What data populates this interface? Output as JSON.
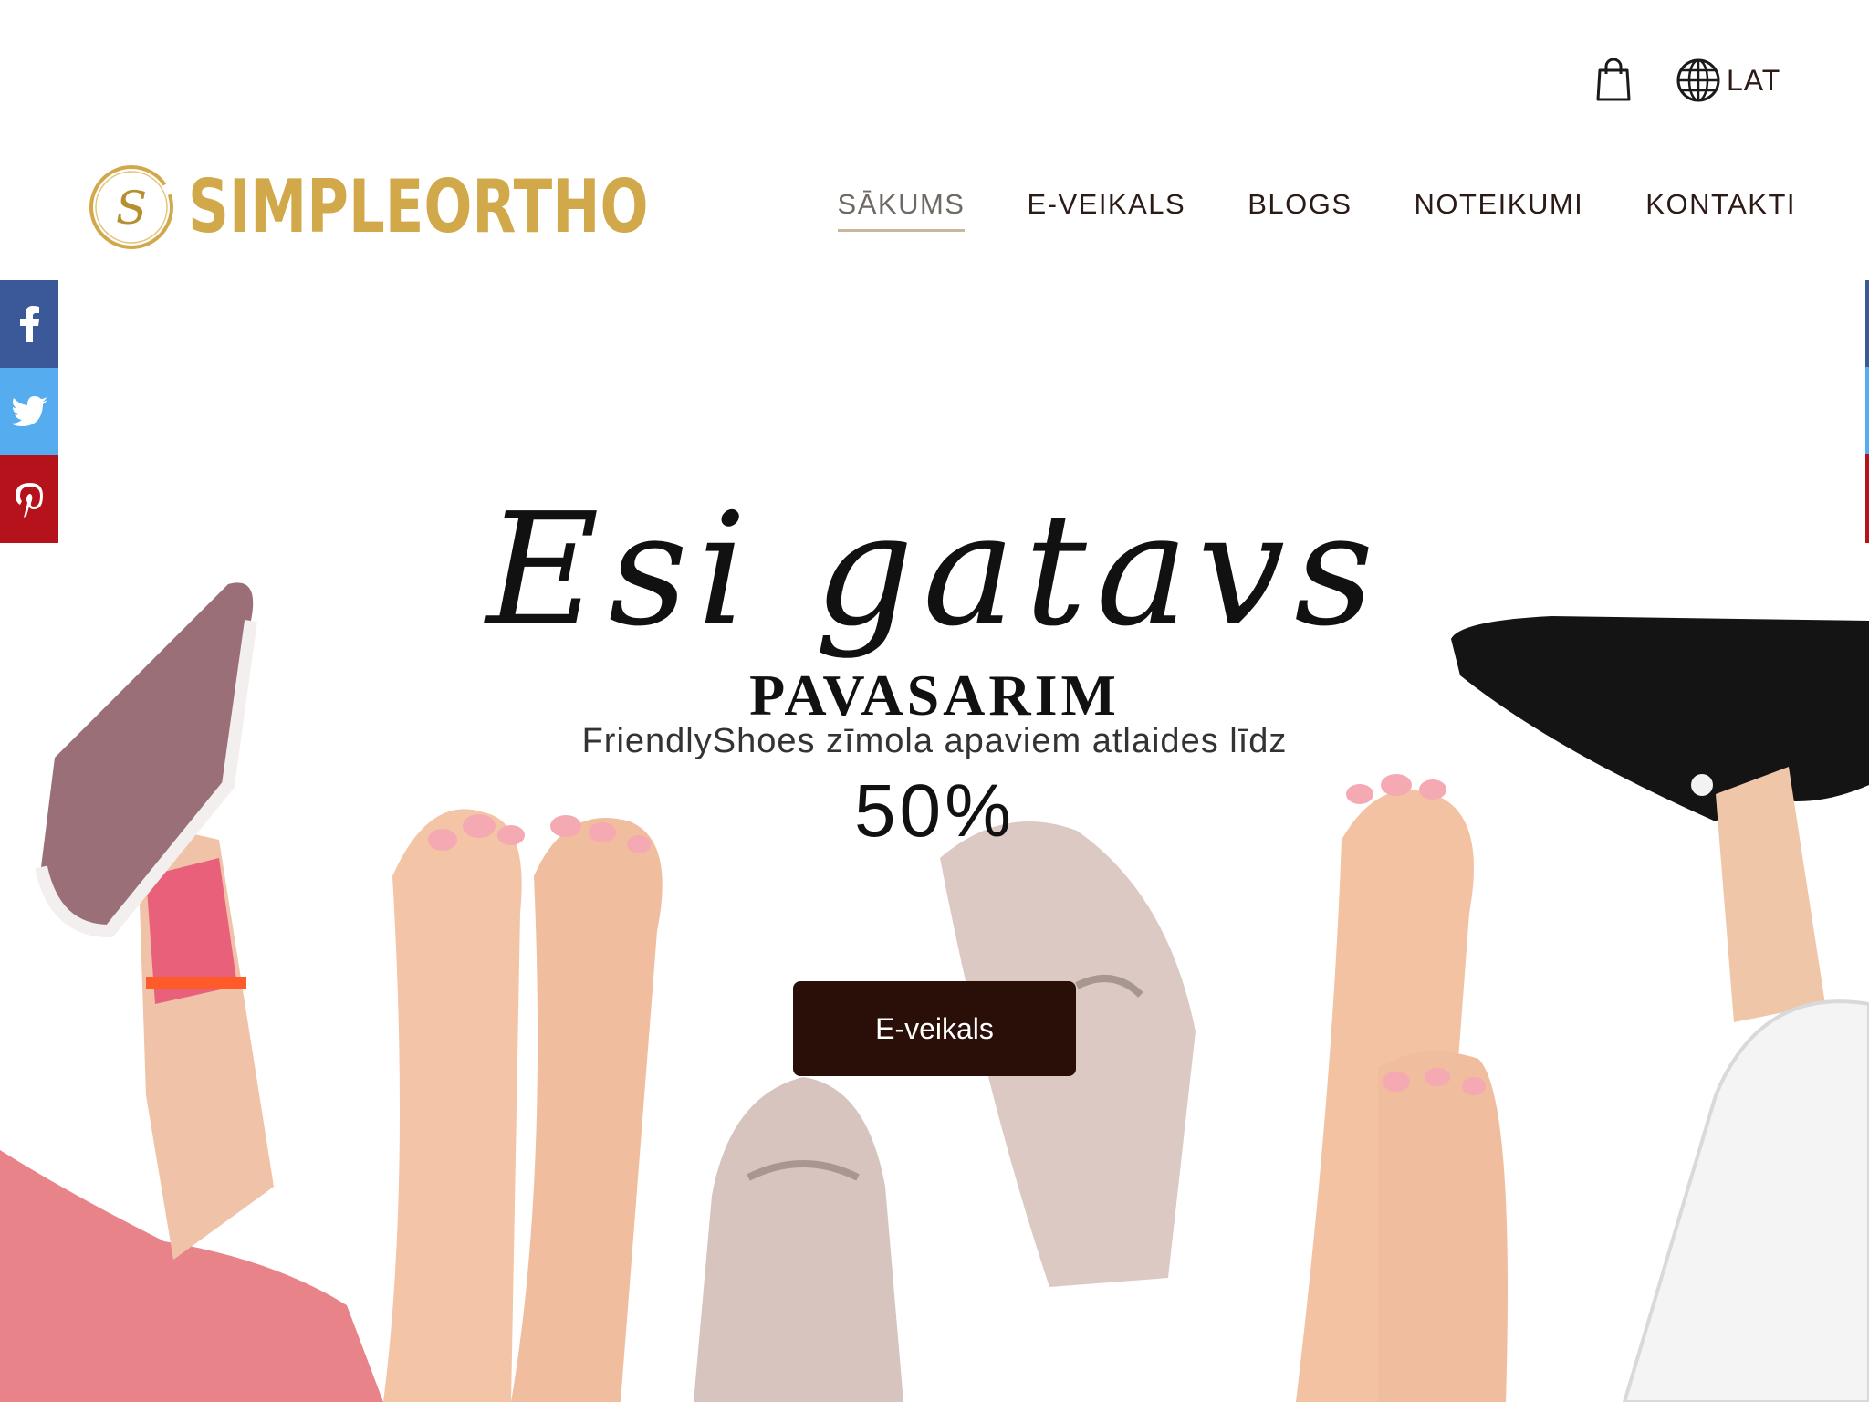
{
  "utility": {
    "cart_icon": "shopping-bag-icon",
    "language_icon": "globe-icon",
    "language_label": "LAT"
  },
  "header": {
    "logo_text": "SIMPLEORTHO",
    "logo_monogram": "S",
    "nav": [
      {
        "label": "SĀKUMS",
        "active": true
      },
      {
        "label": "E-VEIKALS",
        "active": false
      },
      {
        "label": "BLOGS",
        "active": false
      },
      {
        "label": "NOTEIKUMI",
        "active": false
      },
      {
        "label": "KONTAKTI",
        "active": false
      }
    ]
  },
  "social": {
    "facebook_icon": "facebook-icon",
    "twitter_icon": "twitter-icon",
    "pinterest_icon": "pinterest-icon",
    "colors": {
      "facebook": "#3b5998",
      "twitter": "#55acee",
      "pinterest": "#b5121b"
    }
  },
  "hero": {
    "script_text": "Esi gatavs",
    "title": "PAVASARIM",
    "subtitle": "FriendlyShoes zīmola apaviem atlaides līdz",
    "percent": "50%",
    "cta_label": "E-veikals"
  },
  "colors": {
    "brand_gold": "#d1a94a",
    "cta_bg": "#2a0f09",
    "text_dark": "#2b1a16"
  }
}
